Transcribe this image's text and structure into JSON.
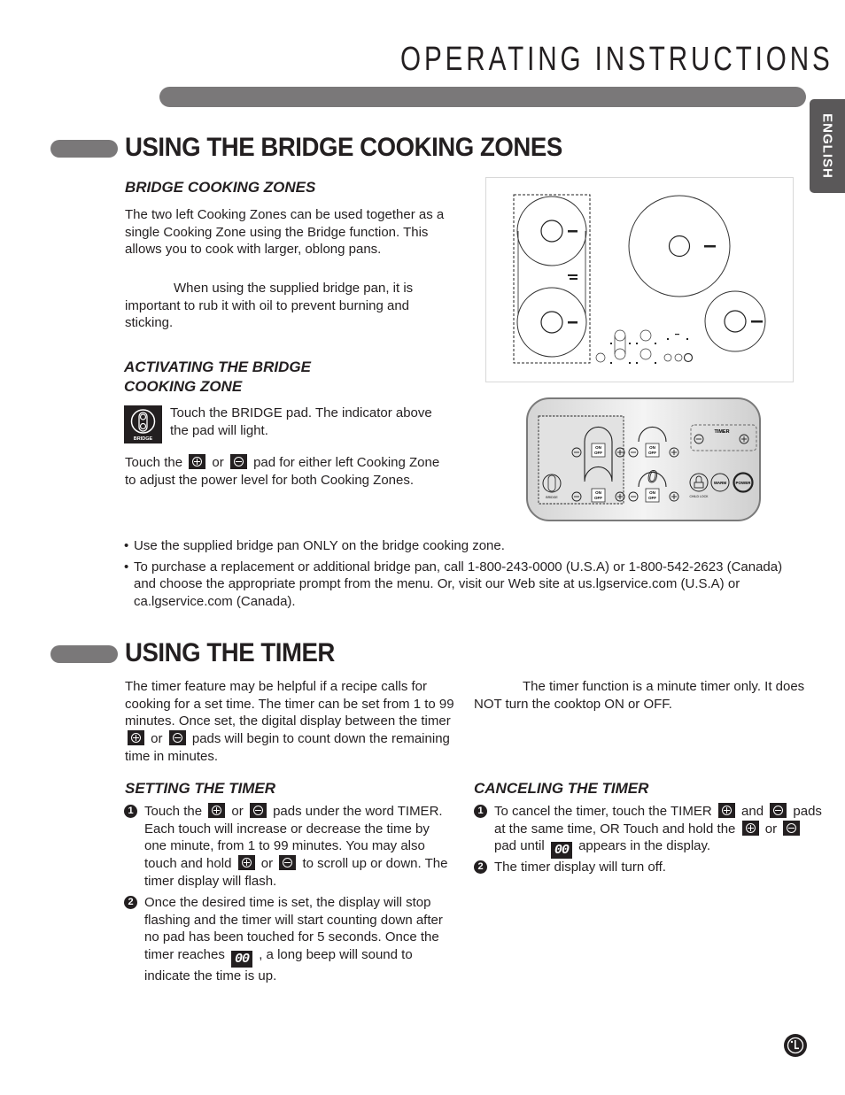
{
  "header": {
    "title": "OPERATING INSTRUCTIONS",
    "language_tab": "ENGLISH"
  },
  "bridge_section": {
    "title": "USING THE BRIDGE COOKING ZONES",
    "subheading": "BRIDGE COOKING ZONES",
    "intro": "The two left Cooking Zones can be used together as a single Cooking Zone using the Bridge function. This allows you to cook with larger, oblong pans.",
    "note": "When using the supplied bridge pan, it is important to rub it with oil to prevent burning and sticking.",
    "activating_heading": "ACTIVATING THE BRIDGE COOKING ZONE",
    "step_bridge": "Touch the BRIDGE pad. The indicator above the pad will light.",
    "bridge_icon_label": "BRIDGE",
    "adjust_prefix": "Touch the",
    "adjust_or": "or",
    "adjust_suffix": "pad for either left Cooking Zone to adjust the power level for both Cooking Zones.",
    "bullets": [
      "Use the supplied bridge pan ONLY on the bridge cooking zone.",
      "To purchase a replacement or additional bridge pan, call 1-800-243-0000 (U.S.A) or 1-800-542-2623 (Canada) and choose the appropriate prompt from the menu. Or, visit our Web site at us.lgservice.com (U.S.A) or ca.lgservice.com (Canada)."
    ]
  },
  "control_panel": {
    "on_label": "ON",
    "off_label": "OFF",
    "timer_label": "TIMER",
    "display_value": "0",
    "bridge_label": "BRIDGE",
    "child_lock_label": "CHILD LOCK",
    "warm_label": "WARM",
    "power_label": "POWER"
  },
  "timer_section": {
    "title": "USING THE TIMER",
    "intro_a": "The timer feature may be helpful if a recipe calls for cooking for a set time. The timer can be set from 1 to 99 minutes. Once set, the digital display between the timer",
    "intro_or": "or",
    "intro_b": "pads will begin to count down the remaining time in minutes.",
    "note": "The timer function is a minute timer only. It does NOT turn the cooktop ON or OFF.",
    "setting_heading": "SETTING THE TIMER",
    "setting_steps": [
      {
        "num": "1",
        "a": "Touch the",
        "or1": "or",
        "b": "pads under the word TIMER. Each touch will increase or decrease the time by one minute, from 1 to 99 minutes. You may also touch and hold",
        "or2": "or",
        "c": "to scroll up or down. The timer display will flash."
      },
      {
        "num": "2",
        "a": "Once the desired time is set, the display will stop flashing and the timer will start counting down after no pad has been touched for 5 seconds. Once the timer reaches",
        "display": "00",
        "b": ", a long beep will sound to indicate the time is up."
      }
    ],
    "canceling_heading": "CANCELING THE TIMER",
    "canceling_steps": [
      {
        "num": "1",
        "a": "To cancel the timer, touch the TIMER",
        "and": "and",
        "b": "pads at the same time, OR Touch and hold the",
        "or": "or",
        "c": "pad until",
        "display": "00",
        "d": "appears in the display."
      },
      {
        "num": "2",
        "a": "The timer display will turn off."
      }
    ]
  },
  "footer": {
    "logo": "LG"
  }
}
